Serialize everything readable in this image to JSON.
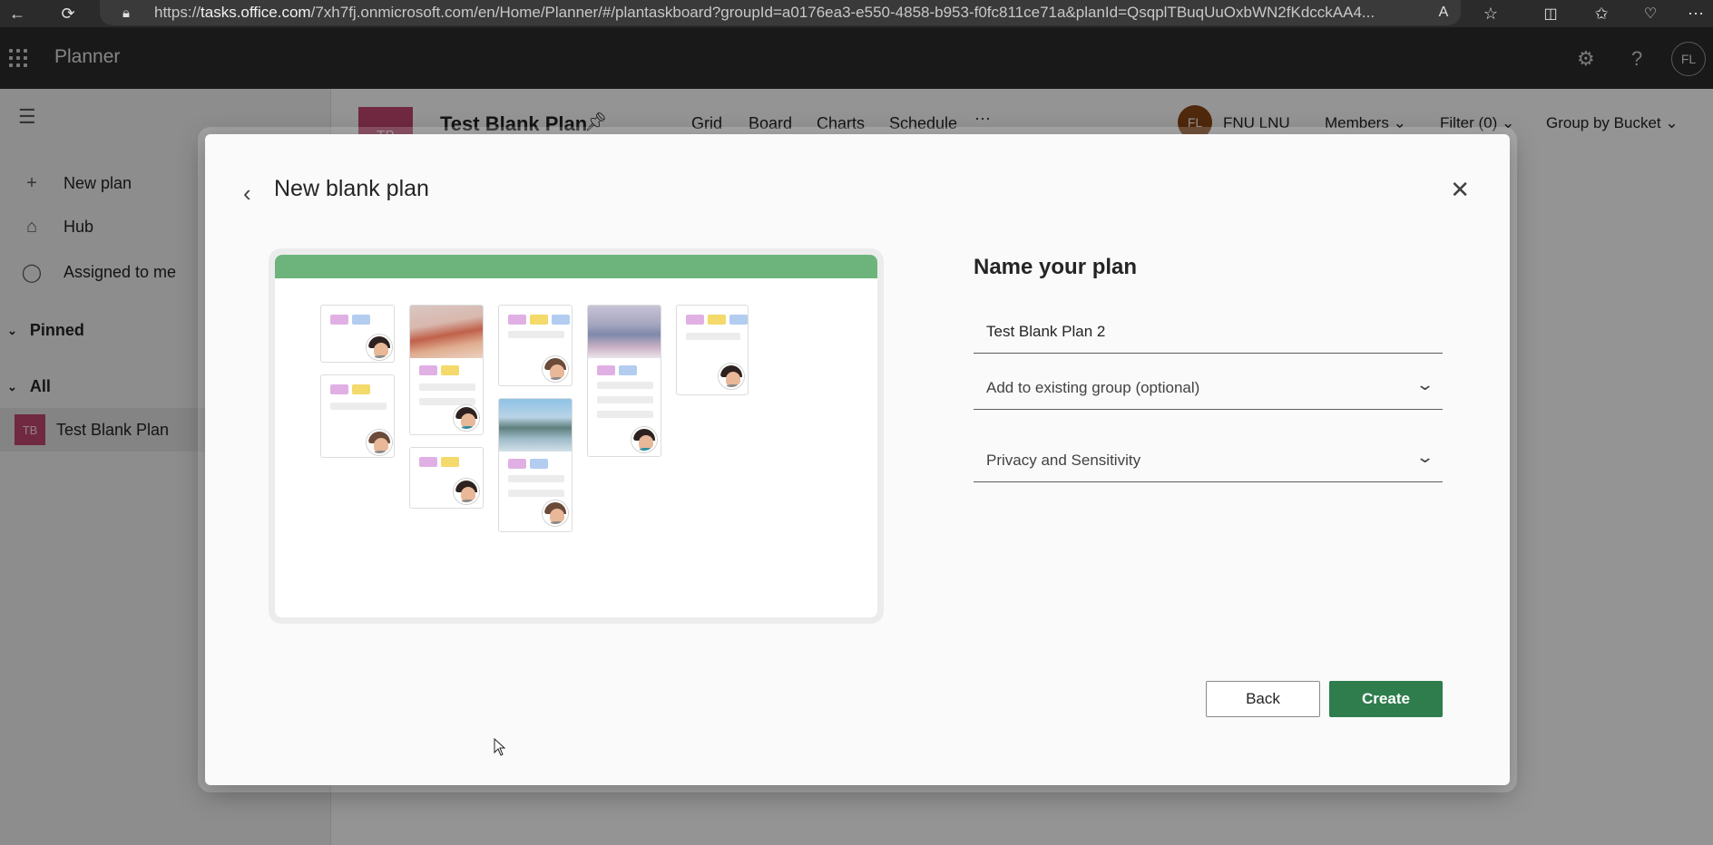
{
  "browser": {
    "url_prefix": "https://",
    "url_domain": "tasks.office.com",
    "url_rest": "/7xh7fj.onmicrosoft.com/en/Home/Planner/#/plantaskboard?groupId=a0176ea3-e550-4858-b953-f0fc811ce71a&planId=QsqplTBuqUuOxbWN2fKdcckAA4..."
  },
  "app": {
    "title": "Planner",
    "user_initials": "FL"
  },
  "sidebar": {
    "new_plan": "New plan",
    "hub": "Hub",
    "assigned": "Assigned to me",
    "pinned": "Pinned",
    "all": "All",
    "plan_badge": "TB",
    "plan_name": "Test Blank Plan"
  },
  "plan_header": {
    "logo": "TB",
    "title": "Test Blank Plan",
    "tabs": [
      "Grid",
      "Board",
      "Charts",
      "Schedule"
    ],
    "more": "···",
    "member_initials": "FL",
    "member_name": "FNU LNU",
    "members": "Members",
    "filter": "Filter (0)",
    "group_by": "Group by Bucket"
  },
  "dialog": {
    "title": "New blank plan",
    "form_title": "Name your plan",
    "plan_name_value": "Test Blank Plan 2",
    "group_placeholder": "Add to existing group (optional)",
    "privacy_placeholder": "Privacy and Sensitivity",
    "back_label": "Back",
    "create_label": "Create"
  },
  "colors": {
    "accent": "#2f7d4d",
    "plan_badge": "#c2476e",
    "illustration_bar": "#6cb47c"
  }
}
